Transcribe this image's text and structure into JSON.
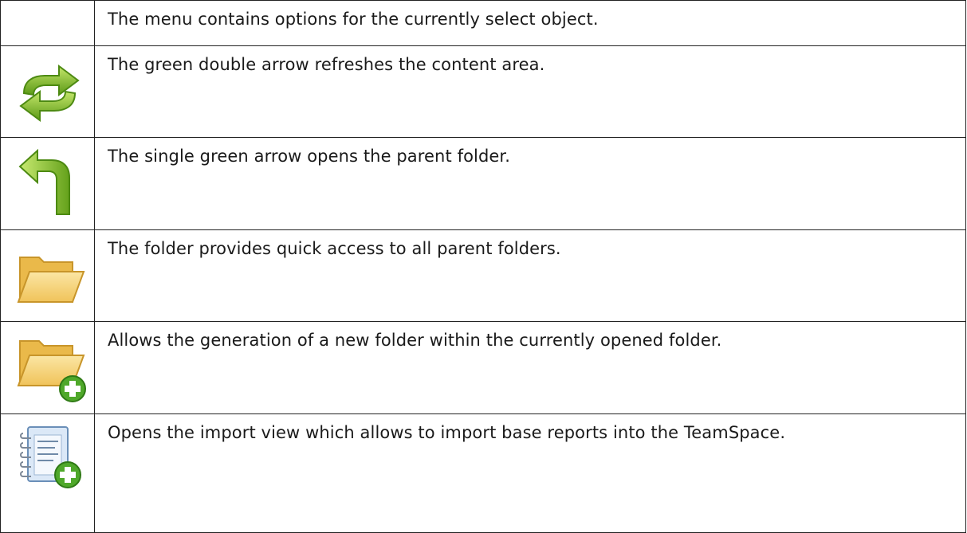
{
  "rows": [
    {
      "icon": "none",
      "text": "The menu contains options for the currently select object."
    },
    {
      "icon": "refresh-double-arrow-icon",
      "text": "The green double arrow refreshes the content area."
    },
    {
      "icon": "parent-folder-arrow-icon",
      "text": "The single green arrow opens the parent folder."
    },
    {
      "icon": "folder-icon",
      "text": "The folder provides quick access to all parent folders."
    },
    {
      "icon": "new-folder-icon",
      "text": "Allows the generation of a new folder within the currently opened folder."
    },
    {
      "icon": "import-report-icon",
      "text": "Opens the import view which allows to import base reports into the TeamSpace."
    }
  ],
  "colors": {
    "border": "#222222",
    "arrow_green": "#7ab827",
    "folder_yellow": "#f5cf6a",
    "plus_green": "#4fa82a"
  }
}
